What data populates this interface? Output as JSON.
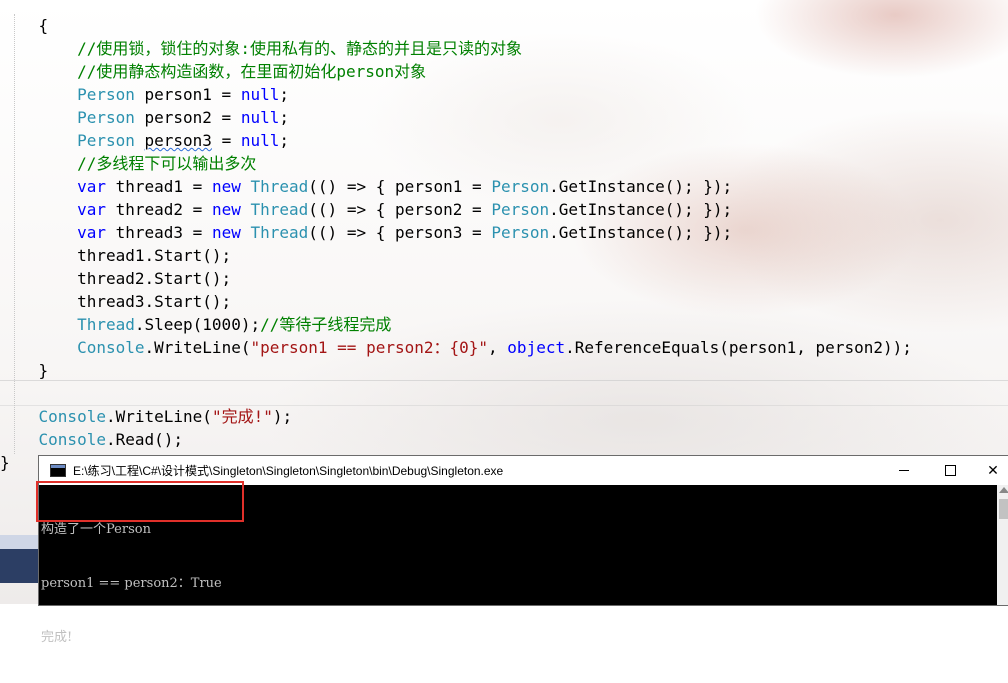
{
  "editor": {
    "lines": [
      [
        {
          "t": "    {",
          "c": ""
        }
      ],
      [
        {
          "t": "        //使用锁，锁住的对象:使用私有的、静态的并且是只读的对象",
          "c": "cmt"
        }
      ],
      [
        {
          "t": "        //使用静态构造函数，在里面初始化person对象",
          "c": "cmt"
        }
      ],
      [
        {
          "t": "        ",
          "c": ""
        },
        {
          "t": "Person",
          "c": "type"
        },
        {
          "t": " person1 = ",
          "c": ""
        },
        {
          "t": "null",
          "c": "kw"
        },
        {
          "t": ";",
          "c": ""
        }
      ],
      [
        {
          "t": "        ",
          "c": ""
        },
        {
          "t": "Person",
          "c": "type"
        },
        {
          "t": " person2 = ",
          "c": ""
        },
        {
          "t": "null",
          "c": "kw"
        },
        {
          "t": ";",
          "c": ""
        }
      ],
      [
        {
          "t": "        ",
          "c": ""
        },
        {
          "t": "Person",
          "c": "type"
        },
        {
          "t": " ",
          "c": ""
        },
        {
          "t": "person3",
          "c": "squig"
        },
        {
          "t": " = ",
          "c": ""
        },
        {
          "t": "null",
          "c": "kw"
        },
        {
          "t": ";",
          "c": ""
        }
      ],
      [
        {
          "t": "        //多线程下可以输出多次",
          "c": "cmt"
        }
      ],
      [
        {
          "t": "        ",
          "c": ""
        },
        {
          "t": "var",
          "c": "kw"
        },
        {
          "t": " thread1 = ",
          "c": ""
        },
        {
          "t": "new",
          "c": "kw"
        },
        {
          "t": " ",
          "c": ""
        },
        {
          "t": "Thread",
          "c": "type"
        },
        {
          "t": "(() => { person1 = ",
          "c": ""
        },
        {
          "t": "Person",
          "c": "type"
        },
        {
          "t": ".GetInstance(); });",
          "c": ""
        }
      ],
      [
        {
          "t": "        ",
          "c": ""
        },
        {
          "t": "var",
          "c": "kw"
        },
        {
          "t": " thread2 = ",
          "c": ""
        },
        {
          "t": "new",
          "c": "kw"
        },
        {
          "t": " ",
          "c": ""
        },
        {
          "t": "Thread",
          "c": "type"
        },
        {
          "t": "(() => { person2 = ",
          "c": ""
        },
        {
          "t": "Person",
          "c": "type"
        },
        {
          "t": ".GetInstance(); });",
          "c": ""
        }
      ],
      [
        {
          "t": "        ",
          "c": ""
        },
        {
          "t": "var",
          "c": "kw"
        },
        {
          "t": " thread3 = ",
          "c": ""
        },
        {
          "t": "new",
          "c": "kw"
        },
        {
          "t": " ",
          "c": ""
        },
        {
          "t": "Thread",
          "c": "type"
        },
        {
          "t": "(() => { person3 = ",
          "c": ""
        },
        {
          "t": "Person",
          "c": "type"
        },
        {
          "t": ".GetInstance(); });",
          "c": ""
        }
      ],
      [
        {
          "t": "        thread1.Start();",
          "c": ""
        }
      ],
      [
        {
          "t": "        thread2.Start();",
          "c": ""
        }
      ],
      [
        {
          "t": "        thread3.Start();",
          "c": ""
        }
      ],
      [
        {
          "t": "        ",
          "c": ""
        },
        {
          "t": "Thread",
          "c": "type"
        },
        {
          "t": ".Sleep(1000);",
          "c": ""
        },
        {
          "t": "//等待子线程完成",
          "c": "cmt"
        }
      ],
      [
        {
          "t": "        ",
          "c": ""
        },
        {
          "t": "Console",
          "c": "type"
        },
        {
          "t": ".WriteLine(",
          "c": ""
        },
        {
          "t": "\"person1 == person2：{0}\"",
          "c": "str"
        },
        {
          "t": ", ",
          "c": ""
        },
        {
          "t": "object",
          "c": "kw"
        },
        {
          "t": ".ReferenceEquals(person1, person2));",
          "c": ""
        }
      ],
      [
        {
          "t": "    }",
          "c": ""
        }
      ],
      [
        {
          "t": "",
          "c": ""
        }
      ],
      [
        {
          "t": "    ",
          "c": ""
        },
        {
          "t": "Console",
          "c": "type"
        },
        {
          "t": ".WriteLine(",
          "c": ""
        },
        {
          "t": "\"完成!\"",
          "c": "str"
        },
        {
          "t": ");",
          "c": ""
        }
      ],
      [
        {
          "t": "    ",
          "c": ""
        },
        {
          "t": "Console",
          "c": "type"
        },
        {
          "t": ".Read();",
          "c": ""
        }
      ],
      [
        {
          "t": "}",
          "c": ""
        }
      ]
    ]
  },
  "console": {
    "title": "E:\\练习\\工程\\C#\\设计模式\\Singleton\\Singleton\\Singleton\\bin\\Debug\\Singleton.exe",
    "close_glyph": "✕",
    "output": [
      "构造了一个Person",
      "person1 == person2：True",
      "完成!"
    ]
  },
  "colors": {
    "keyword": "#0000ff",
    "type": "#2b91af",
    "comment": "#008000",
    "string": "#a31515",
    "highlight_box": "#e0302a"
  }
}
